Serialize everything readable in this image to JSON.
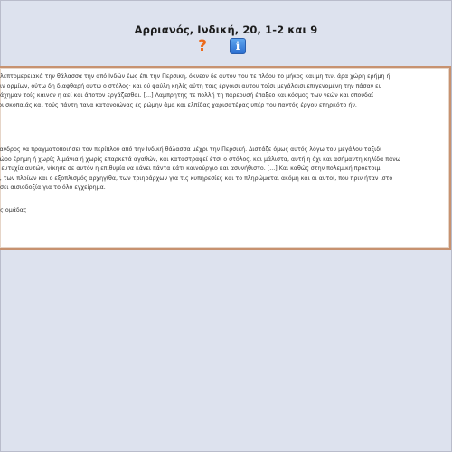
{
  "page": {
    "title": "Αρριανός, Ινδική, 20, 1-2 και 9"
  },
  "icons": {
    "help": {
      "name": "help-icon",
      "glyph": "?",
      "color": "#ec6a1c"
    },
    "info": {
      "name": "info-icon",
      "glyph": "i",
      "color": "#3a86e0"
    }
  },
  "text": {
    "paragraph1": [
      "ι λεπτομερειακά την θάλασσα την από Ινδών έως έπι την Περσική, όκνεον δε αυτον του τε πλόου το μήκος και μη τινι άρα χώρη ερήμη ή",
      "ηιν ορμίων, ούτω δη διαφθαρή αυτω ο στόλος· και ού φαύλη κηλίς αύτη τοις έργοισι αυτου τοίσι μεγάλοισι επιγενομένη την πάσαν ευ",
      "μάχημαν τοίς καινον η αεί και άποτον εργάζεσθαι. [...] Λαμπρητης τε πολλή τη παρεουσή έπαξεο και κόσμος των νεών και σπουδαί",
      "ιοι σκοπαιάς και τούς πάντη πανα κατανοιώνας ές ρώμην άμα και ελπίδας χαρισατέρας υπέρ του παντός έργου επηρκότο ήν."
    ],
    "ref1": "9",
    "paragraph2": [
      "ξανδρος να πραγματοποιήσει τον περίπλου από την Ινδική θάλασσα μέχρι την Περσική. Διστάζε όμως αυτός λόγω του μεγάλου ταξιδι",
      "χώρο έρημη ή χωρίς λιμάνια ή χωρίς επαρκετά αγαθών, και καταστραφεί έτσι ο στόλος, και μάλιστα, αυτή η όχι και ασήμαντη κηλίδα πάνω",
      "ε ευτυχία αυτών, νίκησε σε αυτόν η επιθυμία να κάνει πάντα κάτι καινούργιο και ασυνήθιστο. [...] Και καθώς στην πολεμική προετοιμ",
      "ς, των πλοίων και ο εξοπλισμός αρχηγίθα, των τριηράρχων για τις κυπηρεσίες και το πληρώματα, ακόμη και οι αυτοί, που πριν ήταν ιστο",
      "ησει αισιοδοξία για το όλο εγχείρημα."
    ],
    "ref2": "ας ομάδας"
  }
}
